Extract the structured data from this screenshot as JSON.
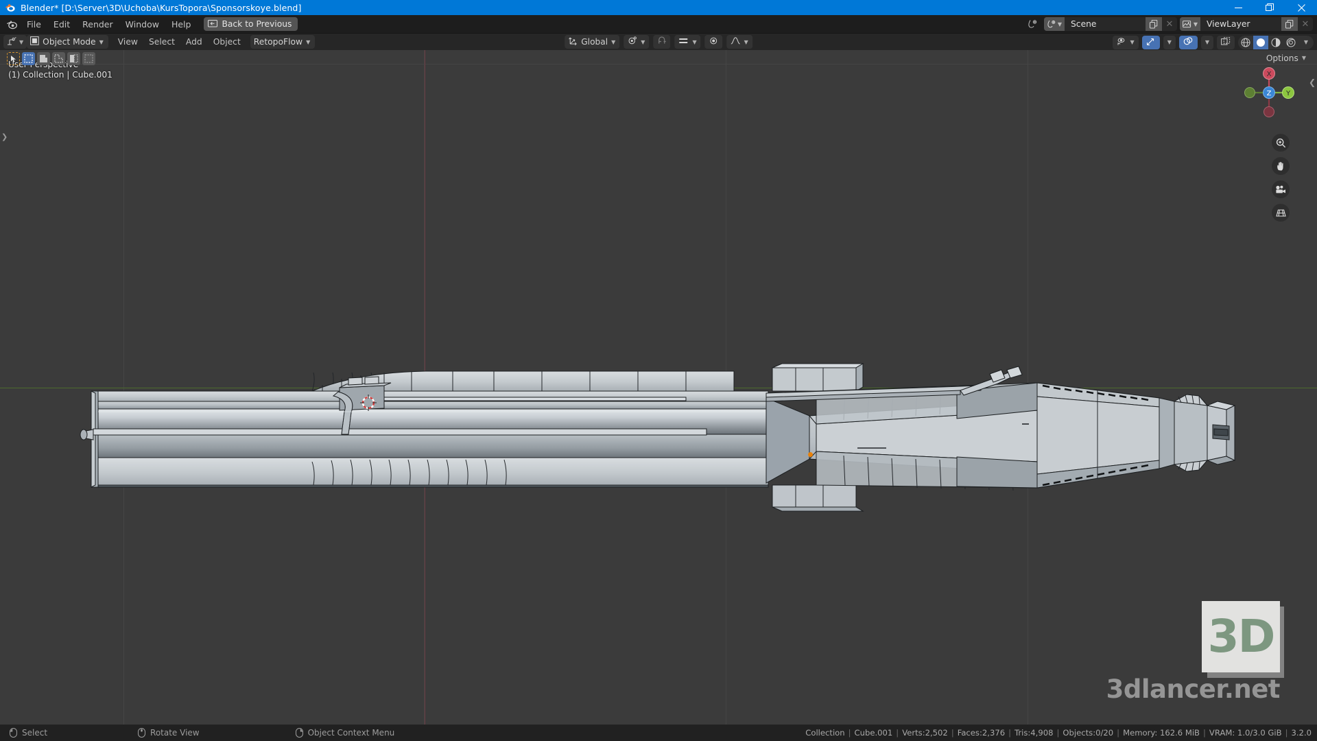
{
  "window": {
    "title": "Blender* [D:\\Server\\3D\\Uchoba\\KursTopora\\Sponsorskoye.blend]",
    "app_icon": "blender-logo-icon",
    "minimize": "minimize-icon",
    "maximize": "restore-icon",
    "close": "close-icon",
    "accent_color": "#0078d7"
  },
  "topbar": {
    "logo": "blender-logo-icon",
    "menus": [
      "File",
      "Edit",
      "Render",
      "Window",
      "Help"
    ],
    "back_button": {
      "label": "Back to Previous",
      "icon": "back-arrow-icon"
    },
    "scene": {
      "icon": "scene-icon",
      "value": "Scene",
      "duplicate_icon": "duplicate-icon",
      "remove_icon": "close-icon"
    },
    "view_layer": {
      "icon": "view-layer-icon",
      "value": "ViewLayer",
      "duplicate_icon": "duplicate-icon",
      "remove_icon": "close-icon"
    }
  },
  "viewport_header": {
    "editor_type": "editor-type-icon",
    "mode": {
      "icon": "object-mode-icon",
      "label": "Object Mode"
    },
    "menus": [
      "View",
      "Select",
      "Add",
      "Object"
    ],
    "addon_menu": "RetopoFlow",
    "transform_orientation": {
      "icon": "orientation-axes-icon",
      "label": "Global"
    },
    "snap": {
      "magnet_icon": "magnet-icon",
      "snap_to_icon": "snap-increment-icon"
    },
    "pivot": {
      "icon": "pivot-median-icon"
    },
    "proportional": {
      "icon": "proportional-edit-icon",
      "falloff_icon": "falloff-smooth-icon"
    },
    "right_controls": {
      "visibility": "show-hide-icon",
      "gizmo": "gizmo-icon",
      "overlays": "overlays-icon",
      "xray": "xray-icon",
      "shading_modes": [
        "wireframe-icon",
        "solid-icon",
        "material-preview-icon",
        "rendered-icon"
      ],
      "active_shading": "solid-icon"
    }
  },
  "viewport": {
    "tools": [
      "tweak-tool-icon",
      "select-box-icon",
      "select-circle-icon",
      "select-lasso-icon",
      "cursor-tool-icon",
      "select-box-alt-icon"
    ],
    "active_tool_index": 1,
    "options_button": "Options",
    "overlay_line1": "User Perspective",
    "overlay_line2": "(1) Collection | Cube.001",
    "gizmo_axes": [
      "X",
      "Y",
      "Z"
    ],
    "nav_buttons": [
      "zoom-icon",
      "pan-hand-icon",
      "camera-view-icon",
      "toggle-ortho-icon"
    ],
    "sidebar_toggle": "chevron-left-icon",
    "background_color": "#3b3b3b",
    "grid_color": "#454545",
    "x_axis_color": "#4d6b2e",
    "y_axis_color": "#6b3a42",
    "object_origin_color": "#e8820c"
  },
  "watermark": {
    "logo_text": "3D",
    "site_text": "3dlancer.net",
    "logo_color": "#7d9780",
    "box_color": "#e2e2e0"
  },
  "statusbar": {
    "keymap": [
      {
        "icon": "mouse-left-icon",
        "label": "Select"
      },
      {
        "icon": "mouse-middle-icon",
        "label": "Rotate View"
      },
      {
        "icon": "mouse-right-icon",
        "label": "Object Context Menu"
      }
    ],
    "stats": [
      "Collection",
      "Cube.001",
      "Verts:2,502",
      "Faces:2,376",
      "Tris:4,908",
      "Objects:0/20",
      "Memory: 162.6 MiB",
      "VRAM: 1.0/3.0 GiB",
      "3.2.0"
    ]
  }
}
